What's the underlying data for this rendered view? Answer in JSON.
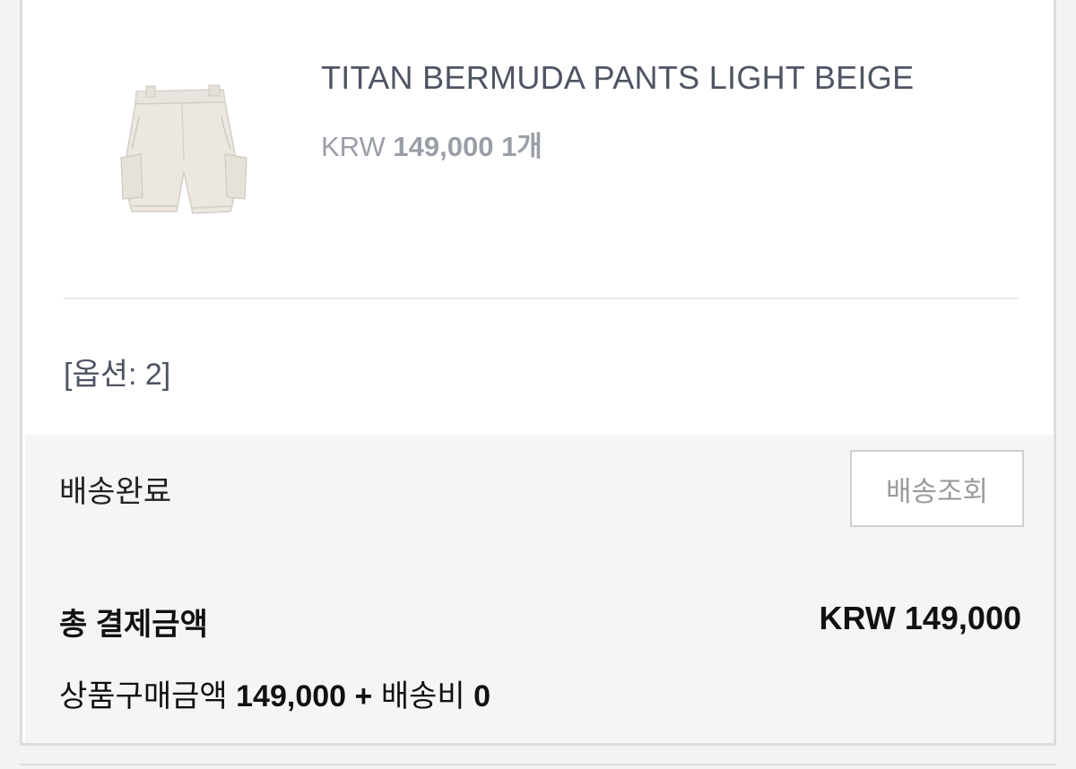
{
  "product": {
    "name": "TITAN BERMUDA PANTS LIGHT BEIGE",
    "currency": "KRW",
    "price": "149,000",
    "quantity": "1개",
    "image": "light-beige-bermuda-shorts-image"
  },
  "option": {
    "text": "[옵션: 2]"
  },
  "delivery": {
    "status": "배송완료",
    "track_button_label": "배송조회"
  },
  "payment": {
    "total_label": "총 결제금액",
    "total_value": "KRW 149,000",
    "items_label": "상품구매금액",
    "items_amount": "149,000",
    "plus": "+",
    "shipping_label": "배송비",
    "shipping_amount": "0"
  },
  "colors": {
    "title_text": "#4f5464",
    "muted_text": "#9a9ea8",
    "panel_bg": "#f5f5f5",
    "border": "#dcdcdc"
  }
}
